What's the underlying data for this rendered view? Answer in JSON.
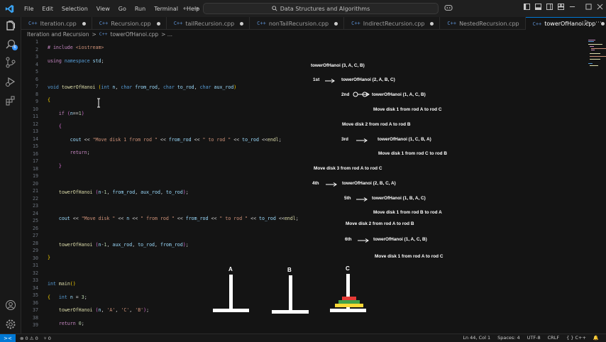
{
  "titlebar": {
    "menu": [
      "File",
      "Edit",
      "Selection",
      "View",
      "Go",
      "Run",
      "Terminal",
      "Help"
    ],
    "search_text": "Data Structures and Algorithms",
    "nav_back": "←",
    "nav_forward": "→"
  },
  "activity": {
    "badge": "6",
    "icons": [
      "explorer-icon",
      "search-icon",
      "source-control-icon",
      "run-debug-icon",
      "extensions-icon",
      "accounts-icon",
      "manage-gear-icon"
    ]
  },
  "tabs": [
    {
      "label": "Iteration.cpp",
      "icon": "C++",
      "active": false,
      "dirty": true
    },
    {
      "label": "Recursion.cpp",
      "icon": "C++",
      "active": false,
      "dirty": true
    },
    {
      "label": "tailRecursion.cpp",
      "icon": "C++",
      "active": false,
      "dirty": true
    },
    {
      "label": "nonTailRecursion.cpp",
      "icon": "C++",
      "active": false,
      "dirty": true
    },
    {
      "label": "IndirectRecursion.cpp",
      "icon": "C++",
      "active": false,
      "dirty": true
    },
    {
      "label": "NestedRecursion.cpp",
      "icon": "C++",
      "active": false,
      "dirty": false
    },
    {
      "label": "towerOfHanoi.cpp",
      "icon": "C++",
      "active": true,
      "dirty": true
    }
  ],
  "tab_actions": {
    "run": "▷",
    "more": "⋯"
  },
  "breadcrumb": {
    "folder": "Iteration and Recursion",
    "sep": ">",
    "file_icon": "C++",
    "file": "towerOfHanoi.cpp",
    "tail": "> ..."
  },
  "editor": {
    "line_numbers": [
      "1",
      "2",
      "3",
      "4",
      "5",
      "6",
      "7",
      "8",
      "9",
      "10",
      "11",
      "12",
      "13",
      "14",
      "15",
      "16",
      "17",
      "18",
      "19",
      "20",
      "21",
      "22",
      "23",
      "24",
      "25",
      "26",
      "27",
      "28",
      "29",
      "30",
      "31",
      "32",
      "33",
      "34",
      "35",
      "36",
      "37",
      "38",
      "39"
    ]
  },
  "annotations": {
    "root_call": "towerOfHanoi (3, A, C, B)",
    "step1_label": "1st",
    "step1_call": "towerOfHanoi (2, A, B, C)",
    "step2_label": "2nd",
    "step2_call": "towerOfHanoi (1, A, C, B)",
    "move_a": "Move disk 1 from rod A to rod C",
    "move_b": "Move disk 2 from rod A to rod B",
    "step3_label": "3rd",
    "step3_call": "towerOfHanoi (1, C, B, A)",
    "move_c": "Move disk 1 from rod C to rod B",
    "move_d": "Move disk 3 from rod A to rod C",
    "step4_label": "4th",
    "step4_call": "towerOfHanoi (2, B, C, A)",
    "step5_label": "5th",
    "step5_call": "towerOfHanoi (1, B, A, C)",
    "move_e": "Move disk 1 from rod B to rod A",
    "move_f": "Move disk 2 from rod A to rod B",
    "step6_label": "6th",
    "step6_call": "towerOfHanoi (1, A, C, B)",
    "move_g": "Move disk 1 from rod A to rod C"
  },
  "towers": {
    "labels": [
      "A",
      "B",
      "C"
    ],
    "disk_colors": [
      "#e53935",
      "#43a047",
      "#fdd835"
    ]
  },
  "statusbar": {
    "remote": "><",
    "problems": "⊗ 0 ⚠ 0",
    "ports": "⑂ 0",
    "position": "Ln 44, Col 1",
    "spaces": "Spaces: 4",
    "encoding": "UTF-8",
    "eol": "CRLF",
    "language": "{ } C++",
    "bell": "🔔"
  }
}
